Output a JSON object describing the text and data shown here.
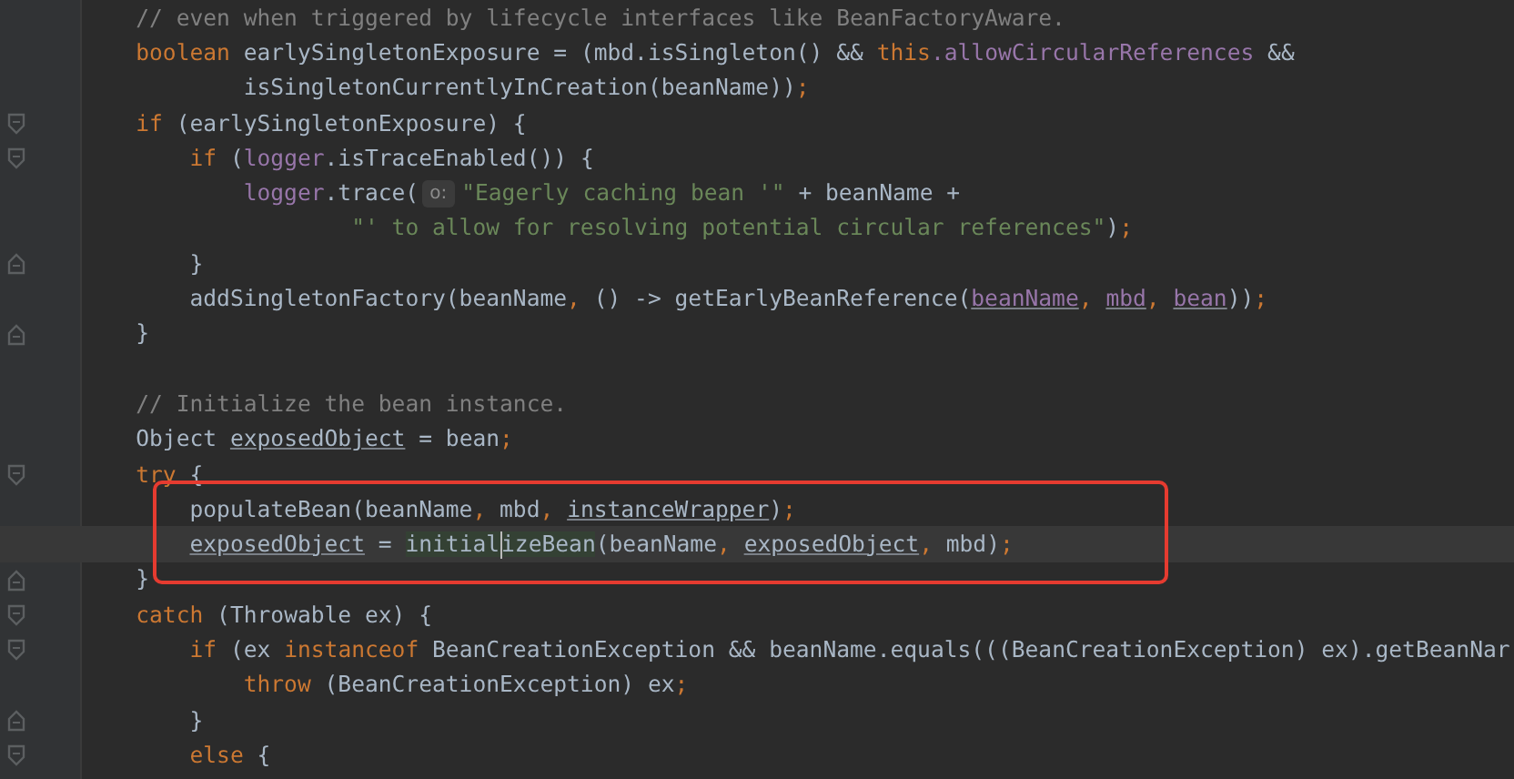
{
  "editor": {
    "lines": [
      {
        "kind": "plain",
        "current": false,
        "boxed": false,
        "tokens": [
          {
            "kind": "comment",
            "t": "    // even when triggered by lifecycle interfaces like BeanFactoryAware."
          }
        ]
      },
      {
        "kind": "plain",
        "current": false,
        "boxed": false,
        "tokens": [
          {
            "kind": "keyword",
            "t": "    boolean "
          },
          {
            "kind": "plain",
            "t": "earlySingletonExposure = (mbd.isSingleton() && "
          },
          {
            "kind": "keyword",
            "t": "this"
          },
          {
            "kind": "field",
            "t": ".allowCircularReferences"
          },
          {
            "kind": "plain",
            "t": " &&"
          }
        ]
      },
      {
        "kind": "plain",
        "current": false,
        "boxed": false,
        "tokens": [
          {
            "kind": "plain",
            "t": "            isSingletonCurrentlyInCreation(beanName))"
          },
          {
            "kind": "punct",
            "t": ";"
          }
        ]
      },
      {
        "kind": "fold-start",
        "current": false,
        "boxed": false,
        "tokens": [
          {
            "kind": "keyword",
            "t": "    if "
          },
          {
            "kind": "plain",
            "t": "(earlySingletonExposure) {"
          }
        ]
      },
      {
        "kind": "fold-start",
        "current": false,
        "boxed": false,
        "tokens": [
          {
            "kind": "keyword",
            "t": "        if "
          },
          {
            "kind": "plain",
            "t": "("
          },
          {
            "kind": "field",
            "t": "logger"
          },
          {
            "kind": "plain",
            "t": ".isTraceEnabled()) {"
          }
        ]
      },
      {
        "kind": "plain",
        "current": false,
        "boxed": false,
        "tokens": [
          {
            "kind": "field",
            "t": "            logger"
          },
          {
            "kind": "plain",
            "t": ".trace("
          },
          {
            "kind": "hint",
            "t": "o:"
          },
          {
            "kind": "string",
            "t": "\"Eagerly caching bean '\""
          },
          {
            "kind": "plain",
            "t": " + beanName +"
          }
        ]
      },
      {
        "kind": "plain",
        "current": false,
        "boxed": false,
        "tokens": [
          {
            "kind": "string",
            "t": "                    \"' to allow for resolving potential circular references\""
          },
          {
            "kind": "plain",
            "t": ")"
          },
          {
            "kind": "punct",
            "t": ";"
          }
        ]
      },
      {
        "kind": "fold-end",
        "current": false,
        "boxed": false,
        "tokens": [
          {
            "kind": "plain",
            "t": "        }"
          }
        ]
      },
      {
        "kind": "plain",
        "current": false,
        "boxed": false,
        "tokens": [
          {
            "kind": "plain",
            "t": "        addSingletonFactory(beanName"
          },
          {
            "kind": "punct",
            "t": ", "
          },
          {
            "kind": "plain",
            "t": "() -> getEarlyBeanReference("
          },
          {
            "kind": "field-underlined",
            "t": "beanName"
          },
          {
            "kind": "punct",
            "t": ", "
          },
          {
            "kind": "field-underlined",
            "t": "mbd"
          },
          {
            "kind": "punct",
            "t": ", "
          },
          {
            "kind": "field-underlined",
            "t": "bean"
          },
          {
            "kind": "plain",
            "t": "))"
          },
          {
            "kind": "punct",
            "t": ";"
          }
        ]
      },
      {
        "kind": "fold-end",
        "current": false,
        "boxed": false,
        "tokens": [
          {
            "kind": "plain",
            "t": "    }"
          }
        ]
      },
      {
        "kind": "plain",
        "current": false,
        "boxed": false
      },
      {
        "kind": "plain",
        "current": false,
        "boxed": false,
        "tokens": [
          {
            "kind": "comment",
            "t": "    // Initialize the bean instance."
          }
        ]
      },
      {
        "kind": "plain",
        "current": false,
        "boxed": false,
        "tokens": [
          {
            "kind": "plain",
            "t": "    Object "
          },
          {
            "kind": "underlined",
            "t": "exposedObject"
          },
          {
            "kind": "plain",
            "t": " = bean"
          },
          {
            "kind": "punct",
            "t": ";"
          }
        ]
      },
      {
        "kind": "fold-start",
        "current": false,
        "boxed": false,
        "tokens": [
          {
            "kind": "keyword",
            "t": "    try "
          },
          {
            "kind": "plain",
            "t": "{"
          }
        ]
      },
      {
        "kind": "plain",
        "current": false,
        "boxed": true,
        "tokens": [
          {
            "kind": "plain",
            "t": "        populateBean(beanName"
          },
          {
            "kind": "punct",
            "t": ", "
          },
          {
            "kind": "plain",
            "t": "mbd"
          },
          {
            "kind": "punct",
            "t": ", "
          },
          {
            "kind": "underlined",
            "t": "instanceWrapper"
          },
          {
            "kind": "plain",
            "t": ")"
          },
          {
            "kind": "punct",
            "t": ";"
          }
        ]
      },
      {
        "kind": "plain",
        "current": true,
        "boxed": true,
        "tokens": [
          {
            "kind": "underlined",
            "t": "        exposedObject"
          },
          {
            "kind": "plain",
            "t": " = "
          },
          {
            "kind": "highlight",
            "t": "initial",
            "caret": true
          },
          {
            "kind": "highlight",
            "t": "izeBean"
          },
          {
            "kind": "plain",
            "t": "(beanName"
          },
          {
            "kind": "punct",
            "t": ", "
          },
          {
            "kind": "underlined",
            "t": "exposedObject"
          },
          {
            "kind": "punct",
            "t": ", "
          },
          {
            "kind": "plain",
            "t": "mbd)"
          },
          {
            "kind": "punct",
            "t": ";"
          }
        ]
      },
      {
        "kind": "fold-end",
        "current": false,
        "boxed": false,
        "tokens": [
          {
            "kind": "plain",
            "t": "    }"
          }
        ]
      },
      {
        "kind": "fold-start",
        "current": false,
        "boxed": false,
        "tokens": [
          {
            "kind": "keyword",
            "t": "    catch "
          },
          {
            "kind": "plain",
            "t": "(Throwable ex) {"
          }
        ]
      },
      {
        "kind": "fold-start",
        "current": false,
        "boxed": false,
        "tokens": [
          {
            "kind": "keyword",
            "t": "        if "
          },
          {
            "kind": "plain",
            "t": "(ex "
          },
          {
            "kind": "keyword",
            "t": "instanceof "
          },
          {
            "kind": "plain",
            "t": "BeanCreationException && beanName.equals(((BeanCreationException) ex).getBeanNar"
          }
        ]
      },
      {
        "kind": "plain",
        "current": false,
        "boxed": false,
        "tokens": [
          {
            "kind": "keyword",
            "t": "            throw "
          },
          {
            "kind": "plain",
            "t": "(BeanCreationException) ex"
          },
          {
            "kind": "punct",
            "t": ";"
          }
        ]
      },
      {
        "kind": "fold-end",
        "current": false,
        "boxed": false,
        "tokens": [
          {
            "kind": "plain",
            "t": "        }"
          }
        ]
      },
      {
        "kind": "fold-start",
        "current": false,
        "boxed": false,
        "tokens": [
          {
            "kind": "keyword",
            "t": "        else "
          },
          {
            "kind": "plain",
            "t": "{"
          }
        ]
      }
    ]
  }
}
